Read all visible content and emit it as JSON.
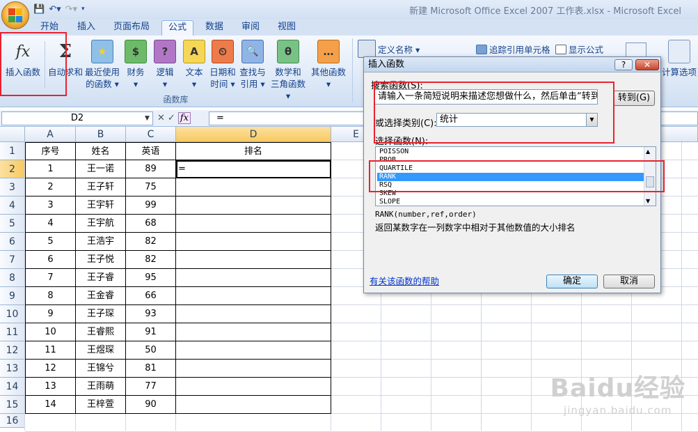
{
  "window": {
    "title": "新建 Microsoft Office Excel 2007 工作表.xlsx - Microsoft Excel"
  },
  "tabs": [
    "开始",
    "插入",
    "页面布局",
    "公式",
    "数据",
    "审阅",
    "视图"
  ],
  "active_tab": "公式",
  "ribbon": {
    "function_library": {
      "label": "函数库",
      "buttons": [
        {
          "line1": "插入函数",
          "line2": ""
        },
        {
          "line1": "自动求和",
          "line2": ""
        },
        {
          "line1": "最近使用",
          "line2": "的函数 ▾"
        },
        {
          "line1": "财务",
          "line2": "▾"
        },
        {
          "line1": "逻辑",
          "line2": "▾"
        },
        {
          "line1": "文本",
          "line2": "▾"
        },
        {
          "line1": "日期和",
          "line2": "时间 ▾"
        },
        {
          "line1": "查找与",
          "line2": "引用 ▾"
        },
        {
          "line1": "数学和",
          "line2": "三角函数 ▾"
        },
        {
          "line1": "其他函数",
          "line2": "▾"
        }
      ],
      "icon_glyphs": [
        "fx",
        "Σ",
        "★",
        "$",
        "?",
        "A",
        "⏲",
        "🔍",
        "θ",
        "…"
      ]
    },
    "define_name": "定义名称 ▾",
    "trace_precedents": "追踪引用单元格",
    "show_formulas": "显示公式",
    "calc_options": "计算选项"
  },
  "formula_bar": {
    "name_box": "D2",
    "formula": "="
  },
  "sheet": {
    "columns": [
      "A",
      "B",
      "C",
      "D",
      "E"
    ],
    "rows": [
      "1",
      "2",
      "3",
      "4",
      "5",
      "6",
      "7",
      "8",
      "9",
      "10",
      "11",
      "12",
      "13",
      "14",
      "15",
      "16"
    ],
    "header": [
      "序号",
      "姓名",
      "英语",
      "排名"
    ],
    "data": [
      [
        "1",
        "王一诺",
        "89",
        "="
      ],
      [
        "2",
        "王子轩",
        "75",
        ""
      ],
      [
        "3",
        "王宇轩",
        "99",
        ""
      ],
      [
        "4",
        "王宇航",
        "68",
        ""
      ],
      [
        "5",
        "王浩宇",
        "82",
        ""
      ],
      [
        "6",
        "王子悦",
        "82",
        ""
      ],
      [
        "7",
        "王子睿",
        "95",
        ""
      ],
      [
        "8",
        "王金睿",
        "66",
        ""
      ],
      [
        "9",
        "王子琛",
        "93",
        ""
      ],
      [
        "10",
        "王睿熙",
        "91",
        ""
      ],
      [
        "11",
        "王煜琛",
        "50",
        ""
      ],
      [
        "12",
        "王锦兮",
        "81",
        ""
      ],
      [
        "13",
        "王雨萌",
        "77",
        ""
      ],
      [
        "14",
        "王梓萱",
        "90",
        ""
      ]
    ]
  },
  "dialog": {
    "title": "插入函数",
    "search_label": "搜索函数(S):",
    "search_value": "请输入一条简短说明来描述您想做什么，然后单击“转到”",
    "goto_label": "转到(G)",
    "category_label": "或选择类别(C):",
    "category_value": "统计",
    "function_label": "选择函数(N):",
    "functions": [
      "POISSON",
      "PROB",
      "QUARTILE",
      "RANK",
      "RSQ",
      "SKEW",
      "SLOPE"
    ],
    "selected_function": "RANK",
    "syntax": "RANK(number,ref,order)",
    "description": "返回某数字在一列数字中相对于其他数值的大小排名",
    "help_link": "有关该函数的帮助",
    "ok_label": "确定",
    "cancel_label": "取消",
    "help_btn": "?",
    "close_btn": "✕"
  },
  "watermark": {
    "brand": "Baidu经验",
    "url": "jingyan.baidu.com"
  },
  "colors": {
    "highlight": "#e8222f",
    "selection": "#3399ff",
    "ribbon_text": "#15428b"
  }
}
